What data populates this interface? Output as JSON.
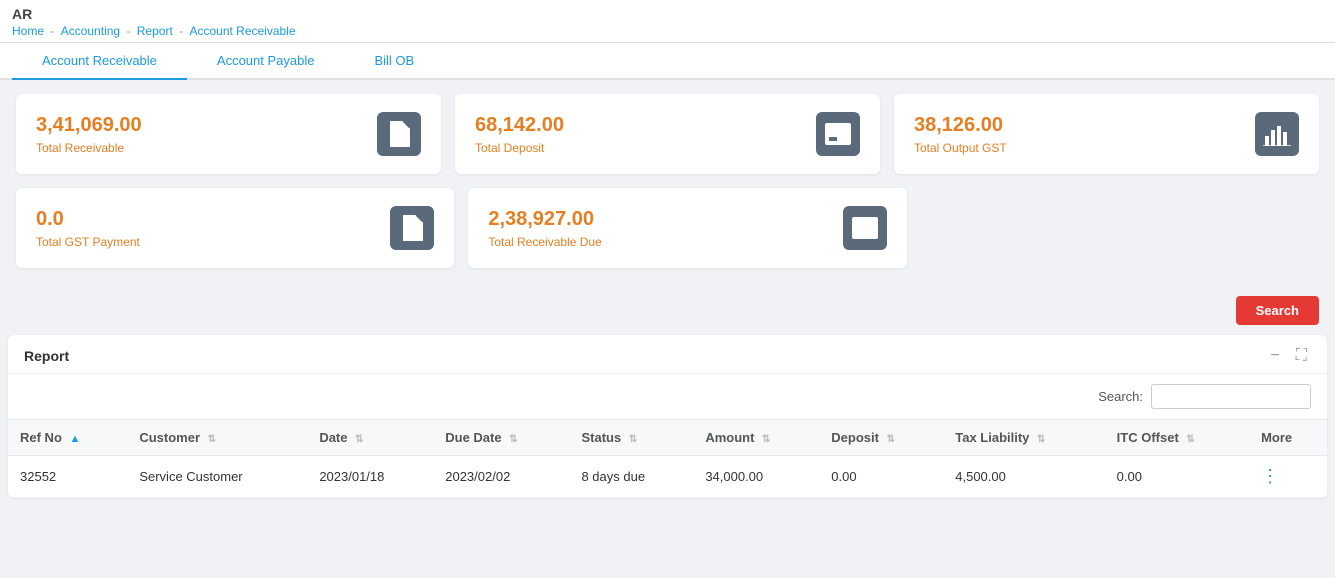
{
  "header": {
    "title": "AR",
    "breadcrumb": [
      "Home",
      "Accounting",
      "Report",
      "Account Receivable"
    ]
  },
  "tabs": [
    {
      "label": "Account Receivable",
      "active": true
    },
    {
      "label": "Account Payable",
      "active": false
    },
    {
      "label": "Bill OB",
      "active": false
    }
  ],
  "cards": [
    [
      {
        "value": "3,41,069.00",
        "label": "Total Receivable",
        "icon": "document"
      },
      {
        "value": "68,142.00",
        "label": "Total Deposit",
        "icon": "deposit"
      }
    ],
    [
      {
        "value": "0.0",
        "label": "Total GST Payment",
        "icon": "document"
      },
      {
        "value": "2,38,927.00",
        "label": "Total Receivable Due",
        "icon": "deposit"
      }
    ],
    [
      {
        "value": "38,126.00",
        "label": "Total Output GST",
        "icon": "chart"
      }
    ]
  ],
  "search_button": "Search",
  "report": {
    "title": "Report",
    "search_label": "Search:",
    "search_placeholder": "",
    "columns": [
      {
        "label": "Ref No",
        "sortable": true,
        "sort_dir": "asc"
      },
      {
        "label": "Customer",
        "sortable": true
      },
      {
        "label": "Date",
        "sortable": true
      },
      {
        "label": "Due Date",
        "sortable": true
      },
      {
        "label": "Status",
        "sortable": true
      },
      {
        "label": "Amount",
        "sortable": true
      },
      {
        "label": "Deposit",
        "sortable": true
      },
      {
        "label": "Tax Liability",
        "sortable": true
      },
      {
        "label": "ITC Offset",
        "sortable": true
      },
      {
        "label": "More",
        "sortable": false
      }
    ],
    "rows": [
      {
        "ref_no": "32552",
        "customer": "Service Customer",
        "date": "2023/01/18",
        "due_date": "2023/02/02",
        "status": "8 days due",
        "amount": "34,000.00",
        "deposit": "0.00",
        "tax_liability": "4,500.00",
        "itc_offset": "0.00"
      }
    ]
  }
}
